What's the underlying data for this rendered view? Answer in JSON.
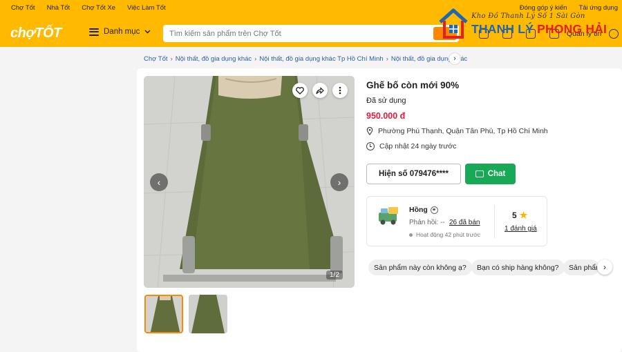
{
  "header": {
    "top_links": [
      "Chợ Tốt",
      "Nhà Tốt",
      "Chợ Tốt Xe",
      "Việc Làm Tốt"
    ],
    "top_links_right": [
      "Đóng góp ý kiến",
      "Tải ứng dụng"
    ],
    "logo": "chợTỐT",
    "category_menu": "Danh mục",
    "search_placeholder": "Tìm kiếm sản phẩm trên Chợ Tốt",
    "manage_label": "Quản lý tin"
  },
  "watermark": {
    "slogan": "Kho Đồ Thanh Lý Số 1 Sài Gòn",
    "brand_part1": "THANH LÝ ",
    "brand_part2": "PHONG HẢI"
  },
  "breadcrumb": [
    "Chợ Tốt",
    "Nội thất, đồ gia dụng khác",
    "Nội thất, đồ gia dụng khác Tp Hồ Chí Minh",
    "Nội thất, đồ gia dụng khác"
  ],
  "gallery": {
    "counter": "1/2"
  },
  "product": {
    "title": "Ghế bố còn mới 90%",
    "condition": "Đã sử dụng",
    "price": "950.000 đ",
    "location": "Phường Phú Thạnh, Quận Tân Phú, Tp Hồ Chí Minh",
    "updated": "Cập nhật 24 ngày trước"
  },
  "actions": {
    "phone": "Hiện số 079476****",
    "chat": "Chat"
  },
  "seller": {
    "name": "Hồng",
    "reply_label": "Phản hồi: --",
    "sold": "26 đã bán",
    "active": "Hoạt động 42 phút trước",
    "rating": "5",
    "reviews": "1 đánh giá"
  },
  "quick_messages": [
    "Sản phẩm này còn không ạ?",
    "Bạn có ship hàng không?",
    "Sản phẩm"
  ],
  "colors": {
    "header_bg": "#ffba00",
    "price": "#e5193b",
    "chat_button": "#18a957",
    "link": "#2a5db0"
  }
}
